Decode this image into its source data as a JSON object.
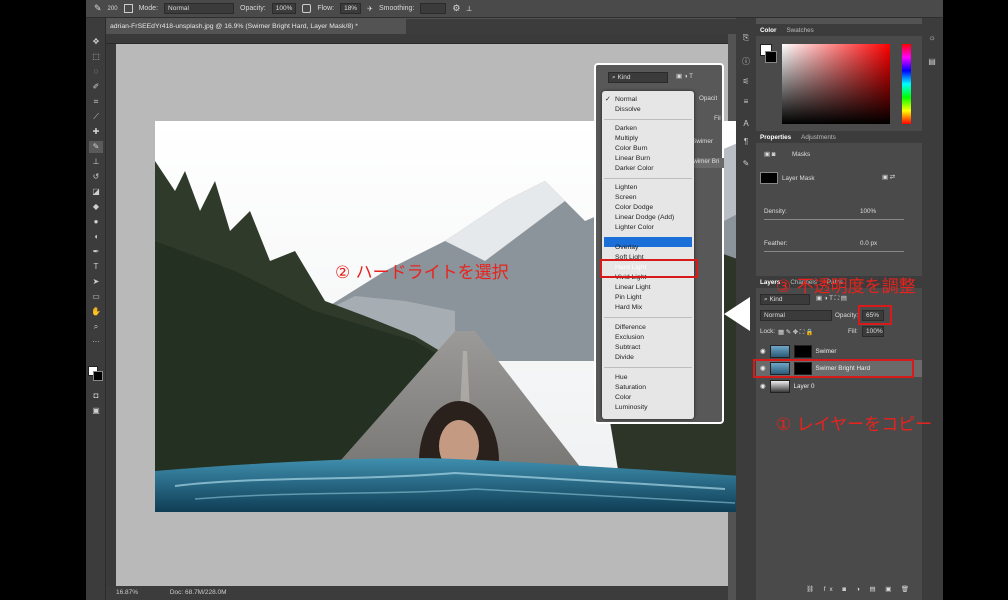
{
  "optbar": {
    "brush_size": "200",
    "mode_label": "Mode:",
    "mode_value": "Normal",
    "opacity_label": "Opacity:",
    "opacity_value": "100%",
    "flow_label": "Flow:",
    "flow_value": "18%",
    "smoothing_label": "Smoothing:"
  },
  "doc_tab": "adrian-FrSEEdYr418-unsplash.jpg @ 16.9% (Swimer Bright Hard, Layer Mask/8) *",
  "status": {
    "zoom": "16.87%",
    "doc": "Doc: 68.7M/228.0M"
  },
  "color_panel": {
    "tabs": [
      "Color",
      "Swatches"
    ],
    "hue": "#ff0000"
  },
  "properties": {
    "tabs": [
      "Properties",
      "Adjustments"
    ],
    "masks_label": "Masks",
    "layer_mask_label": "Layer Mask",
    "density_label": "Density:",
    "density_value": "100%",
    "feather_label": "Feather:",
    "feather_value": "0.0 px"
  },
  "layers": {
    "tabs": [
      "Layers",
      "Channels",
      "Paths"
    ],
    "kind": "Kind",
    "blend": "Normal",
    "opacity_label": "Opacity:",
    "opacity_value": "65%",
    "lock_label": "Lock:",
    "fill_label": "Fill:",
    "fill_value": "100%",
    "items": [
      {
        "name": "Swimer"
      },
      {
        "name": "Swimer Bright Hard"
      },
      {
        "name": "Layer 0"
      }
    ]
  },
  "blend_popup": {
    "kind": "Kind",
    "behind_opacity": "Opacit",
    "behind_fill": "Fil",
    "behind_layer1": "Swimer",
    "behind_layer2": "Swimer Bri",
    "checked": "Normal",
    "selected": "Hard Light",
    "groups": [
      [
        "Normal",
        "Dissolve"
      ],
      [
        "Darken",
        "Multiply",
        "Color Burn",
        "Linear Burn",
        "Darker Color"
      ],
      [
        "Lighten",
        "Screen",
        "Color Dodge",
        "Linear Dodge (Add)",
        "Lighter Color"
      ],
      [
        "Overlay",
        "Soft Light",
        "Hard Light",
        "Vivid Light",
        "Linear Light",
        "Pin Light",
        "Hard Mix"
      ],
      [
        "Difference",
        "Exclusion",
        "Subtract",
        "Divide"
      ],
      [
        "Hue",
        "Saturation",
        "Color",
        "Luminosity"
      ]
    ]
  },
  "annotations": {
    "step1": "① レイヤーをコピー",
    "step2": "② ハードライトを選択",
    "step3": "③ 不透明度を調整"
  },
  "colors": {
    "annotation": "#e8231d",
    "highlight": "#1a6fd8"
  }
}
